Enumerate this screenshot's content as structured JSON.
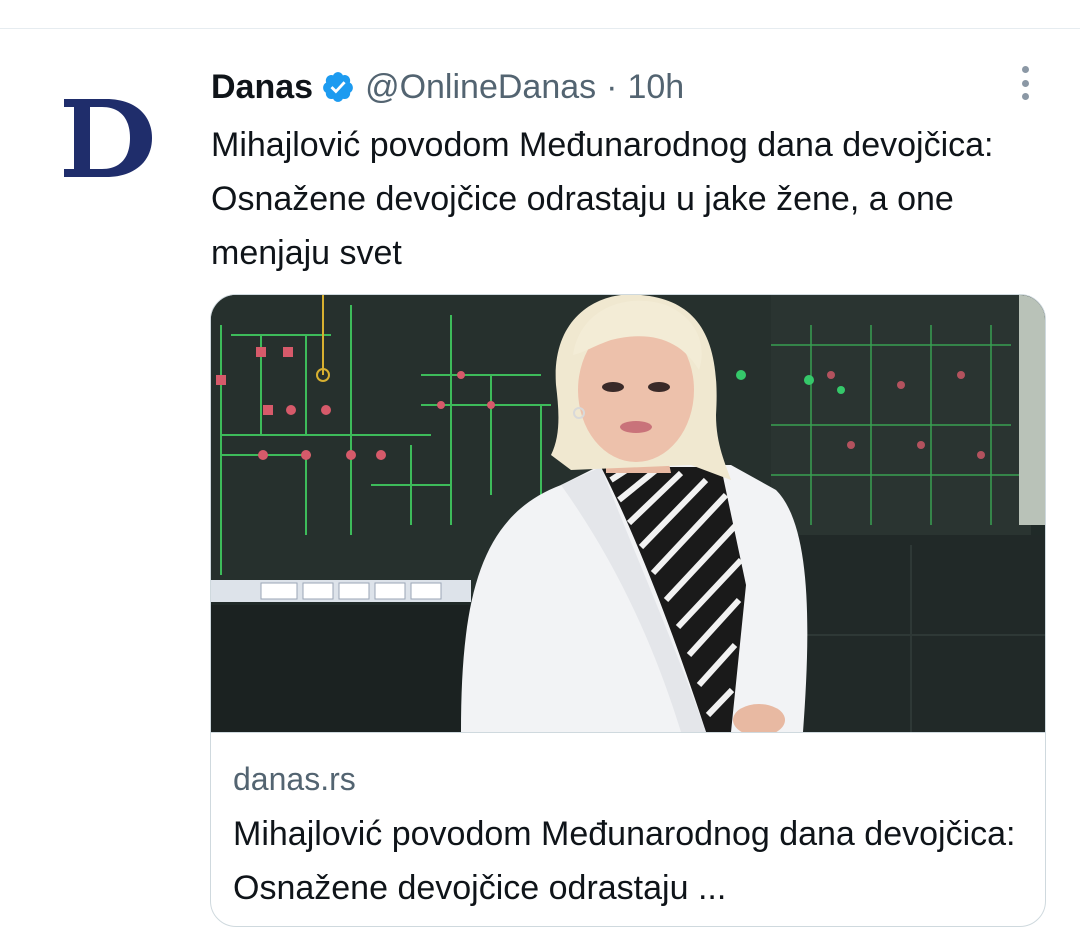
{
  "tweet": {
    "author_name": "Danas",
    "handle": "@OnlineDanas",
    "separator": "·",
    "time": "10h",
    "text": "Mihajlović povodom Međunarodnog dana devojčica: Osnažene devojčice odrastaju u jake žene, a one menjaju svet",
    "avatar_letter": "D"
  },
  "card": {
    "domain": "danas.rs",
    "title": "Mihajlović povodom Međunarodnog dana devojčica: Osnažene devojčice odrastaju ..."
  },
  "icons": {
    "verified": "verified-badge-icon",
    "more": "more-options-icon"
  },
  "colors": {
    "avatar_blue": "#1f2d6b",
    "verified_blue": "#1d9bf0",
    "secondary_text": "#536471",
    "border": "#cfd9de"
  }
}
